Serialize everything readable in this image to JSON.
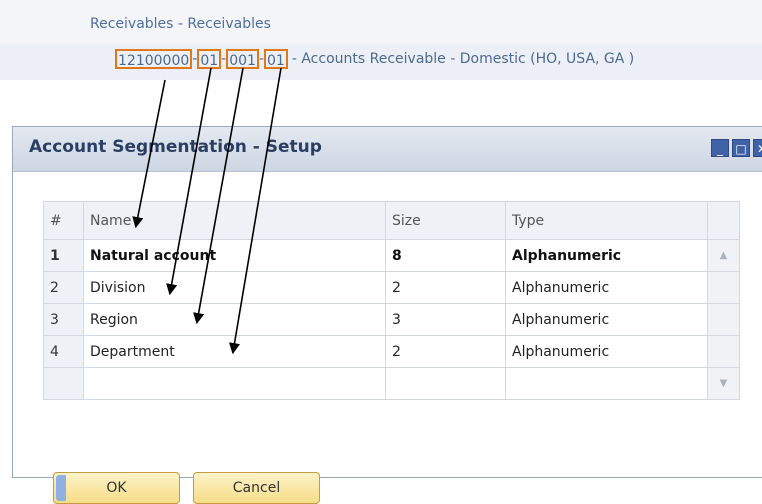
{
  "breadcrumb": "Receivables - Receivables",
  "account": {
    "segments": [
      "12100000",
      "01",
      "001",
      "01"
    ],
    "separator": "-",
    "description": "- Accounts Receivable - Domestic (HO, USA, GA )"
  },
  "dialog": {
    "title": "Account Segmentation - Setup",
    "window_buttons": [
      "_",
      "□",
      "✕"
    ],
    "columns": [
      "#",
      "Name",
      "Size",
      "Type"
    ],
    "rows": [
      {
        "num": "1",
        "name": "Natural account",
        "size": "8",
        "type": "Alphanumeric",
        "bold": true
      },
      {
        "num": "2",
        "name": "Division",
        "size": "2",
        "type": "Alphanumeric"
      },
      {
        "num": "3",
        "name": "Region",
        "size": "3",
        "type": "Alphanumeric"
      },
      {
        "num": "4",
        "name": "Department",
        "size": "2",
        "type": "Alphanumeric"
      }
    ],
    "ok_label": "OK",
    "cancel_label": "Cancel"
  },
  "colors": {
    "highlight_border": "#e0771b",
    "arrow": "#000000",
    "title_text": "#2a3f63"
  },
  "icons": {
    "scroll_up": "scroll-up-icon",
    "scroll_down": "scroll-down-icon"
  }
}
